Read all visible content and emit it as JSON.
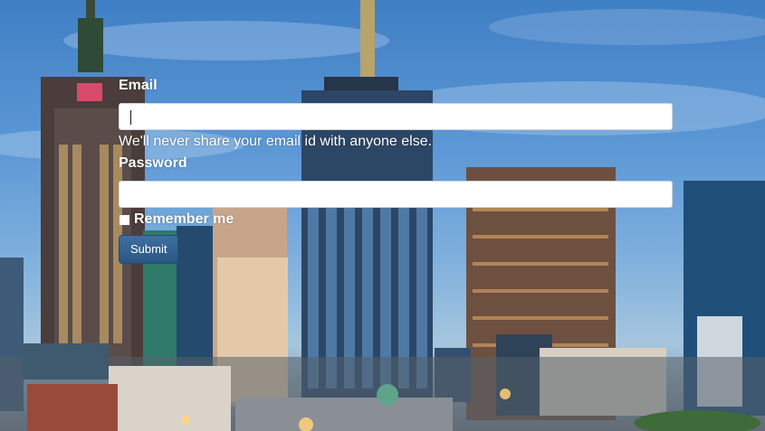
{
  "background": {
    "description_icon": "city-skyline-photo-icon"
  },
  "form": {
    "email_label": "Email",
    "email_value": "",
    "email_help": "We'll never share your email id with anyone else.",
    "password_label": "Password",
    "password_value": "",
    "remember_label": "Remember me",
    "remember_checked": true,
    "submit_label": "Submit"
  },
  "colors": {
    "submit_bg": "#2d5b8a",
    "text": "#ffffff"
  }
}
